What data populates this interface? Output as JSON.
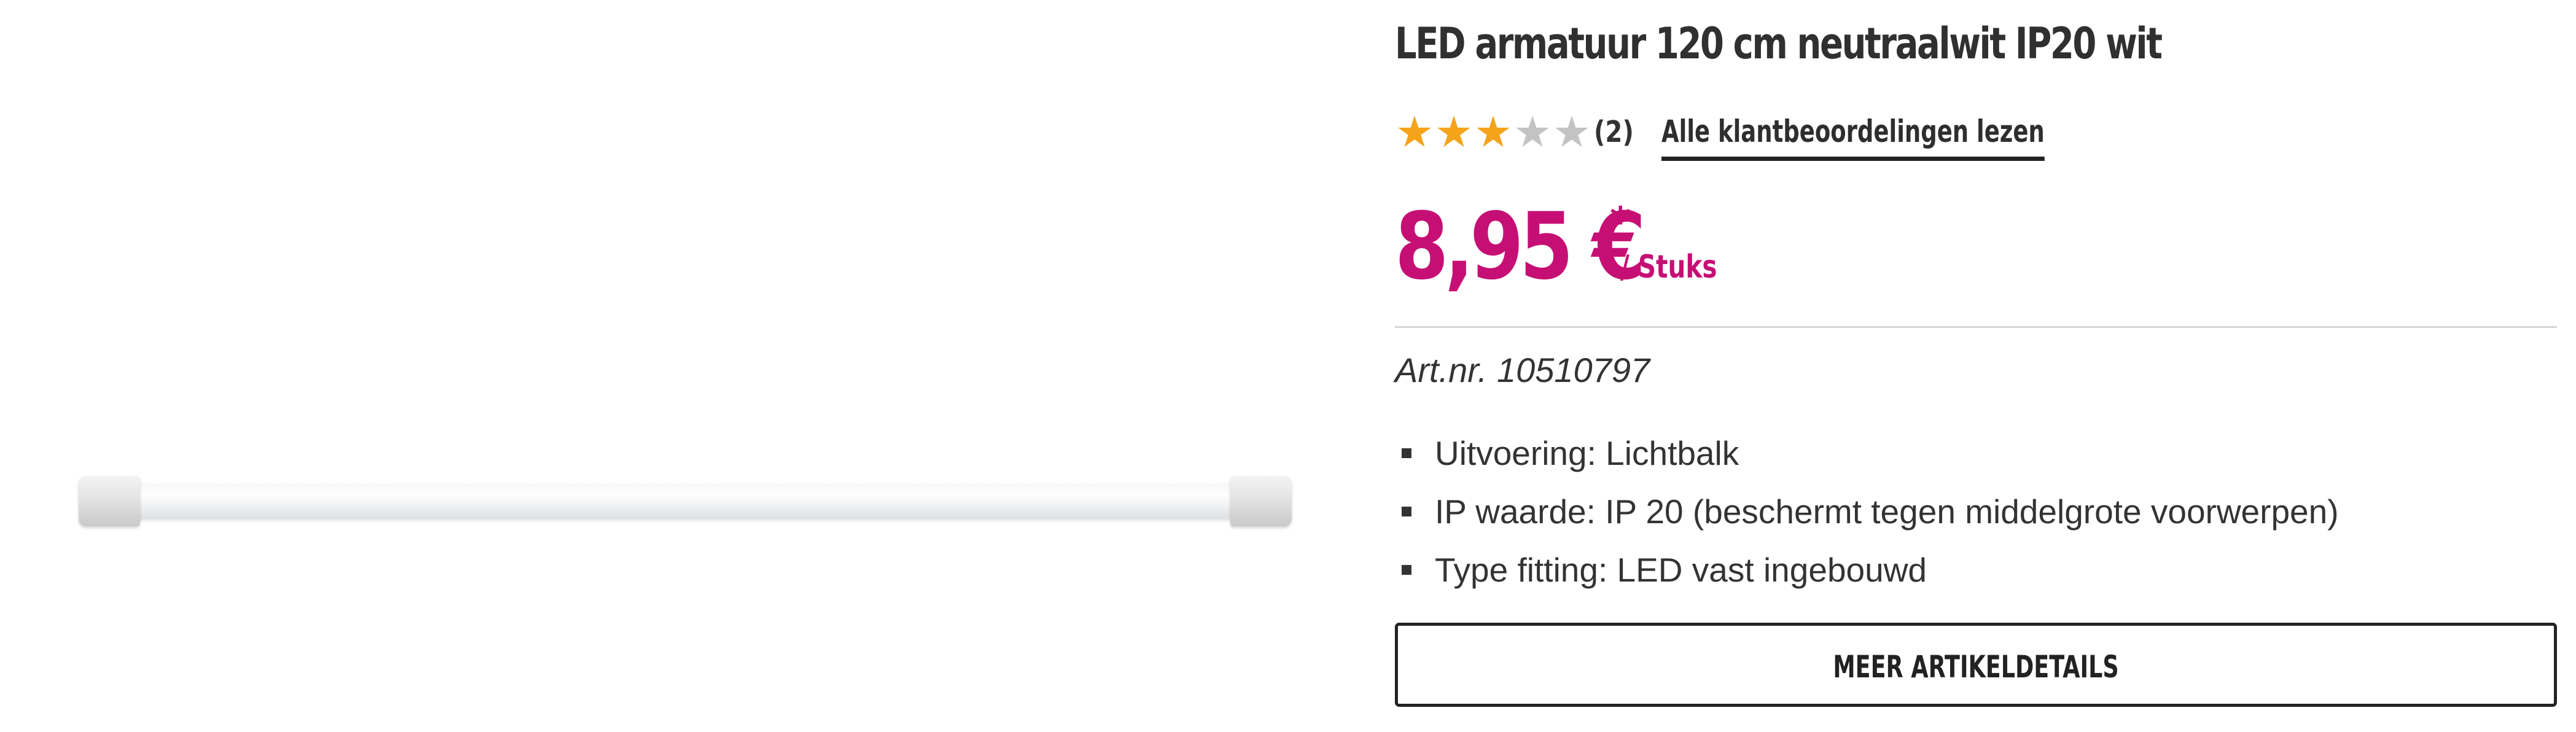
{
  "product": {
    "image_alt": "LED armatuur lichtbalk",
    "title": "LED armatuur 120 cm neutraalwit IP20 wit"
  },
  "rating": {
    "value": 3,
    "max": 5,
    "count_label": "(2)",
    "reviews_link": "Alle klantbeoordelingen lezen",
    "star_filled_color": "#f5a31b",
    "star_empty_color": "#c3c3c3",
    "icon": "star-icon"
  },
  "price": {
    "amount": "8,95 €",
    "footnote_marker": "*",
    "unit": "/ Stuks",
    "color": "#c60f74"
  },
  "article": {
    "number_label": "Art.nr. 10510797"
  },
  "features": [
    {
      "text": "Uitvoering: Lichtbalk"
    },
    {
      "text": "IP waarde: IP 20 (beschermt tegen middelgrote voorwerpen)"
    },
    {
      "text": "Type fitting: LED vast ingebouwd"
    }
  ],
  "actions": {
    "more_details_label": "MEER ARTIKELDETAILS"
  }
}
